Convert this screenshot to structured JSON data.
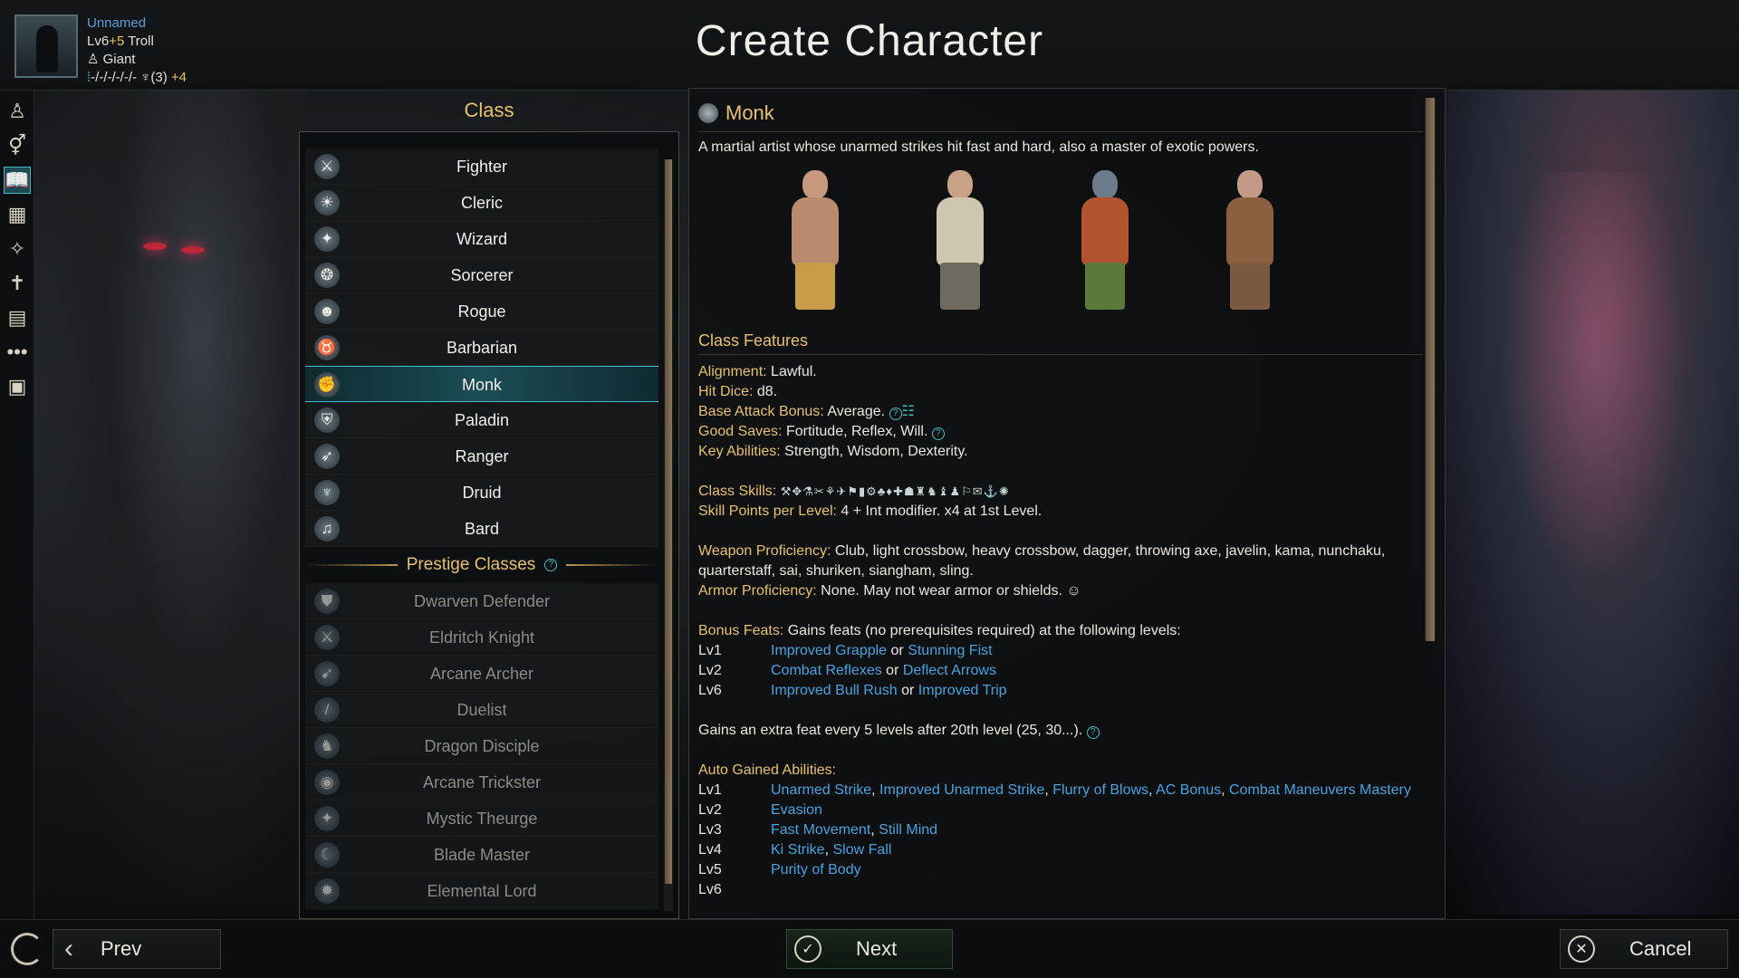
{
  "page": {
    "title": "Create Character"
  },
  "character": {
    "name": "Unnamed",
    "level_line_base": "Lv6",
    "level_line_plus": "+5",
    "race": "Troll",
    "size": "Giant",
    "stats_line": "-/-/-/-/-/-",
    "deity_line": "(3)",
    "bonus": "+4"
  },
  "sidebar": {
    "icons": [
      {
        "name": "race-icon",
        "glyph": "♙"
      },
      {
        "name": "gender-icon",
        "glyph": "⚥"
      },
      {
        "name": "class-icon",
        "glyph": "📖",
        "active": true
      },
      {
        "name": "abilities-icon",
        "glyph": "▦"
      },
      {
        "name": "skills-icon",
        "glyph": "✧"
      },
      {
        "name": "feats-icon",
        "glyph": "✝"
      },
      {
        "name": "spells-icon",
        "glyph": "▤"
      },
      {
        "name": "more-icon",
        "glyph": "•••"
      },
      {
        "name": "summary-icon",
        "glyph": "▣"
      }
    ]
  },
  "class_panel": {
    "header": "Class",
    "classes": [
      {
        "label": "Fighter",
        "icon": "⚔"
      },
      {
        "label": "Cleric",
        "icon": "☀"
      },
      {
        "label": "Wizard",
        "icon": "✦"
      },
      {
        "label": "Sorcerer",
        "icon": "❂"
      },
      {
        "label": "Rogue",
        "icon": "☻"
      },
      {
        "label": "Barbarian",
        "icon": "♉"
      },
      {
        "label": "Monk",
        "icon": "✊",
        "selected": true
      },
      {
        "label": "Paladin",
        "icon": "⛨"
      },
      {
        "label": "Ranger",
        "icon": "➶"
      },
      {
        "label": "Druid",
        "icon": "♆"
      },
      {
        "label": "Bard",
        "icon": "♫"
      }
    ],
    "prestige_header": "Prestige Classes",
    "prestige_classes": [
      {
        "label": "Dwarven Defender",
        "icon": "⛊"
      },
      {
        "label": "Eldritch Knight",
        "icon": "⚔"
      },
      {
        "label": "Arcane Archer",
        "icon": "➹"
      },
      {
        "label": "Duelist",
        "icon": "/"
      },
      {
        "label": "Dragon Disciple",
        "icon": "♞"
      },
      {
        "label": "Arcane Trickster",
        "icon": "◉"
      },
      {
        "label": "Mystic Theurge",
        "icon": "✦"
      },
      {
        "label": "Blade Master",
        "icon": "☾"
      },
      {
        "label": "Elemental Lord",
        "icon": "✹"
      }
    ]
  },
  "detail": {
    "class_name": "Monk",
    "description": "A martial artist whose unarmed strikes hit fast and hard, also a master of exotic powers.",
    "features_title": "Class Features",
    "alignment_label": "Alignment:",
    "alignment_value": " Lawful.",
    "hitdice_label": "Hit Dice:",
    "hitdice_value": " d8.",
    "bab_label": "Base Attack Bonus:",
    "bab_value": " Average.",
    "saves_label": "Good Saves:",
    "saves_value": " Fortitude, Reflex, Will.",
    "key_label": "Key Abilities:",
    "key_value": " Strength, Wisdom, Dexterity.",
    "skills_label": "Class Skills:",
    "skills_glyphs": "⚒✥⚗✂⚘✈⚑▮⚙♣♦✚☗♜♞♝♟⚐✉⚓✺",
    "skillpts_label": "Skill Points per Level:",
    "skillpts_value": " 4 + Int modifier. x4 at 1st Level.",
    "weapon_label": "Weapon Proficiency:",
    "weapon_value": " Club, light crossbow, heavy crossbow, dagger, throwing axe, javelin, kama, nunchaku, quarterstaff, sai, shuriken, siangham, sling.",
    "armor_label": "Armor Proficiency:",
    "armor_value": " None. May not wear armor or shields.",
    "bonus_label": "Bonus Feats:",
    "bonus_value": " Gains feats (no prerequisites required) at the following levels:",
    "bonus_feats": [
      {
        "lv": "Lv1",
        "a": "Improved Grapple",
        "or": " or ",
        "b": "Stunning Fist"
      },
      {
        "lv": "Lv2",
        "a": "Combat Reflexes",
        "or": " or ",
        "b": "Deflect Arrows"
      },
      {
        "lv": "Lv6",
        "a": "Improved Bull Rush",
        "or": " or ",
        "b": "Improved Trip"
      }
    ],
    "extra_feat": "Gains an extra feat every 5 levels after 20th level (25, 30...).",
    "auto_label": "Auto Gained Abilities:",
    "auto": [
      {
        "lv": "Lv1",
        "items": [
          "Unarmed Strike",
          "Improved Unarmed Strike",
          "Flurry of Blows",
          "AC Bonus",
          "Combat Maneuvers Mastery"
        ]
      },
      {
        "lv": "Lv2",
        "items": [
          "Evasion"
        ]
      },
      {
        "lv": "Lv3",
        "items": [
          "Fast Movement",
          "Still Mind"
        ]
      },
      {
        "lv": "Lv4",
        "items": [
          "Ki Strike",
          "Slow Fall"
        ]
      },
      {
        "lv": "Lv5",
        "items": [
          "Purity of Body"
        ]
      },
      {
        "lv": "Lv6",
        "items": []
      }
    ]
  },
  "buttons": {
    "prev": "Prev",
    "next": "Next",
    "cancel": "Cancel"
  },
  "colors": {
    "accent_gold": "#e8c072",
    "link_blue": "#4aa3e0",
    "selection_teal": "#3dc0cc"
  }
}
